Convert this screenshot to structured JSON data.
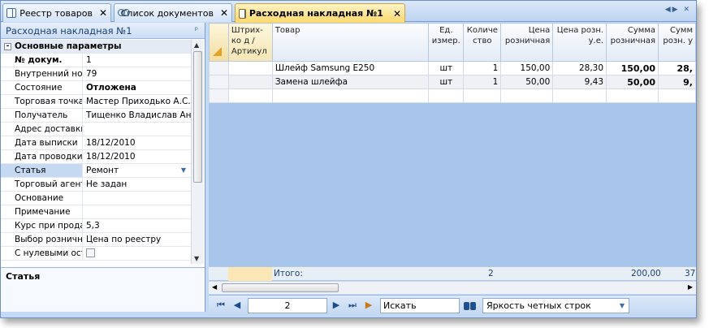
{
  "tabs": [
    {
      "label": "Реестр товаров"
    },
    {
      "label": "Список документов"
    },
    {
      "label": "Расходная накладная №1"
    }
  ],
  "left_panel": {
    "title": "Расходная накладная №1",
    "category": "Основные параметры",
    "properties": [
      {
        "key": "№ докум.",
        "value": "1"
      },
      {
        "key": "Внутренний ном",
        "value": "79"
      },
      {
        "key": "Состояние",
        "value": "Отложена"
      },
      {
        "key": "Торговая точка",
        "value": "Мастер Приходько А.С."
      },
      {
        "key": "Получатель",
        "value": "Тищенко Владислав Андр"
      },
      {
        "key": "Адрес доставки",
        "value": ""
      },
      {
        "key": "Дата выписки",
        "value": "18/12/2010"
      },
      {
        "key": "Дата проводки",
        "value": "18/12/2010"
      },
      {
        "key": "Статья",
        "value": "Ремонт"
      },
      {
        "key": "Торговый агент",
        "value": "Не задан"
      },
      {
        "key": "Основание",
        "value": ""
      },
      {
        "key": "Примечание",
        "value": ""
      },
      {
        "key": "Курс при прода",
        "value": "5,3"
      },
      {
        "key": "Выбор розничн",
        "value": "Цена по реестру"
      },
      {
        "key": "С нулевыми ост",
        "value": ""
      }
    ],
    "description_title": "Статья"
  },
  "grid": {
    "headers": {
      "barcode": "Штрих-ко д / Артикул",
      "product": "Товар",
      "unit": "Ед. измер.",
      "qty": "Количе ство",
      "price_retail": "Цена розничная",
      "price_retail_ue": "Цена розн. у.е.",
      "sum_retail": "Сумма розничная",
      "sum_retail_ue": "Сумм розн. у"
    },
    "rows": [
      {
        "barcode": "",
        "product": "Шлейф Samsung E250",
        "unit": "шт",
        "qty": "1",
        "price_retail": "150,00",
        "price_retail_ue": "28,30",
        "sum_retail": "150,00",
        "sum_retail_ue": "28,"
      },
      {
        "barcode": "",
        "product": "Замена шлейфа",
        "unit": "шт",
        "qty": "1",
        "price_retail": "50,00",
        "price_retail_ue": "9,43",
        "sum_retail": "50,00",
        "sum_retail_ue": "9,"
      }
    ],
    "totals": {
      "label": "Итого:",
      "qty": "2",
      "sum_retail": "200,00",
      "sum_retail_ue": "37"
    }
  },
  "navigator": {
    "page": "2",
    "search_placeholder": "Искать",
    "brightness_label": "Яркость четных строк"
  },
  "colors": {
    "active_tab": "#fbd86e",
    "grid_background": "#a8c6ec",
    "panel_header": "#1c3f74"
  }
}
